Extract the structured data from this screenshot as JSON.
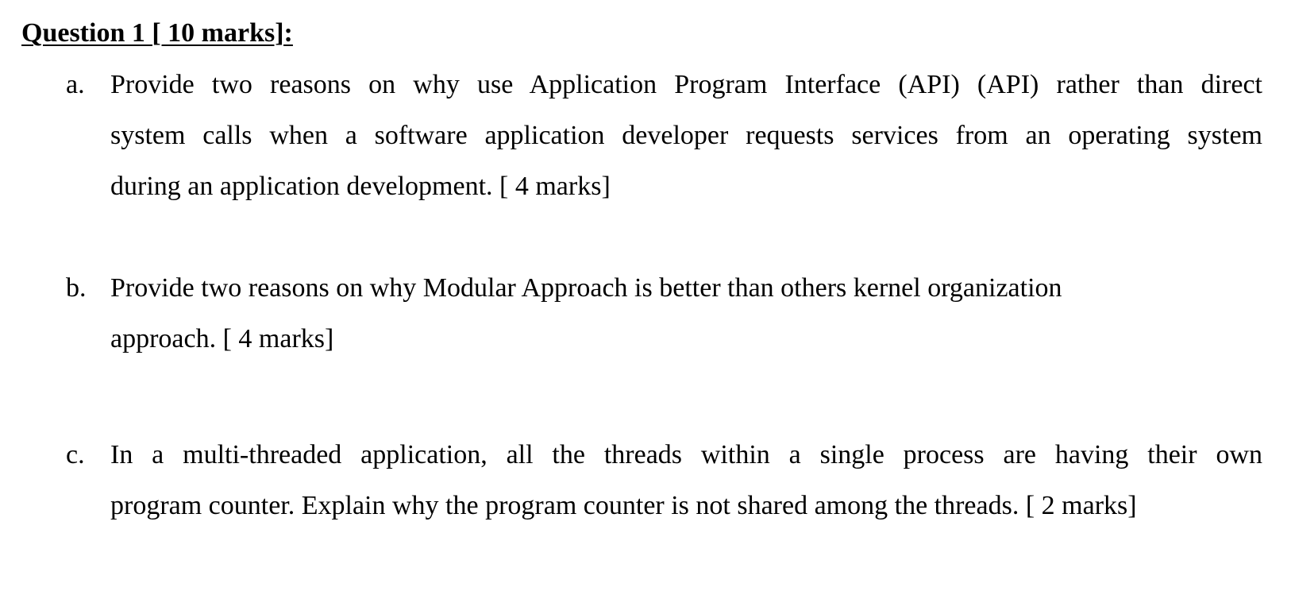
{
  "heading": "Question 1 [ 10 marks]:",
  "questions": [
    {
      "marker": "a.",
      "lines": [
        "Provide two reasons on why use Application Program Interface (API) (API) rather than direct",
        "system calls when a software application developer requests services from an operating system",
        "during an application development.  [ 4 marks]"
      ]
    },
    {
      "marker": "b.",
      "lines": [
        "Provide two reasons on why Modular Approach is better than others kernel organization",
        "approach.  [ 4 marks]"
      ]
    },
    {
      "marker": "c.",
      "lines": [
        "In a multi-threaded application, all the threads within a single process are having their own",
        "program counter.  Explain why the program counter is not shared among the threads. [ 2 marks]"
      ]
    }
  ]
}
